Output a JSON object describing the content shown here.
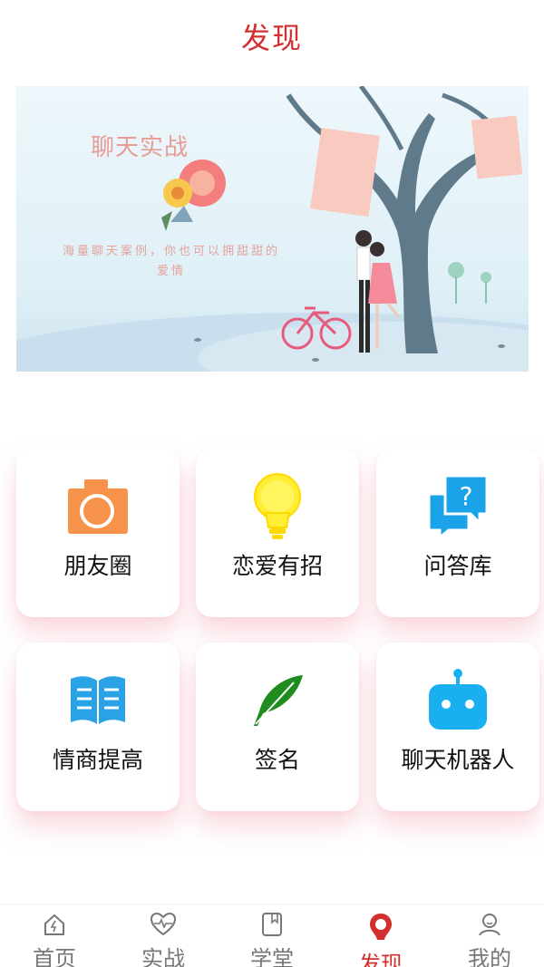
{
  "header": {
    "title": "发现"
  },
  "banner": {
    "title": "聊天实战",
    "subtitle": "海量聊天案例，你也可以拥甜甜的爱情"
  },
  "features": [
    {
      "label": "朋友圈",
      "icon": "camera-icon"
    },
    {
      "label": "恋爱有招",
      "icon": "lightbulb-icon"
    },
    {
      "label": "问答库",
      "icon": "question-chat-icon"
    },
    {
      "label": "情商提高",
      "icon": "book-icon"
    },
    {
      "label": "签名",
      "icon": "feather-icon"
    },
    {
      "label": "聊天机器人",
      "icon": "robot-icon"
    }
  ],
  "tabbar": {
    "active": "发现",
    "items": [
      {
        "label": "首页",
        "icon": "home-icon"
      },
      {
        "label": "实战",
        "icon": "heartbeat-icon"
      },
      {
        "label": "学堂",
        "icon": "notebook-icon"
      },
      {
        "label": "发现",
        "icon": "bulb-pin-icon"
      },
      {
        "label": "我的",
        "icon": "user-icon"
      }
    ]
  },
  "colors": {
    "accent": "#d32f2f",
    "camera": "#f7924a",
    "bulb": "#ffee33",
    "question": "#1aa3e8",
    "book": "#2aa2e6",
    "feather": "#1e8c1e",
    "robot": "#1ab0f0"
  }
}
